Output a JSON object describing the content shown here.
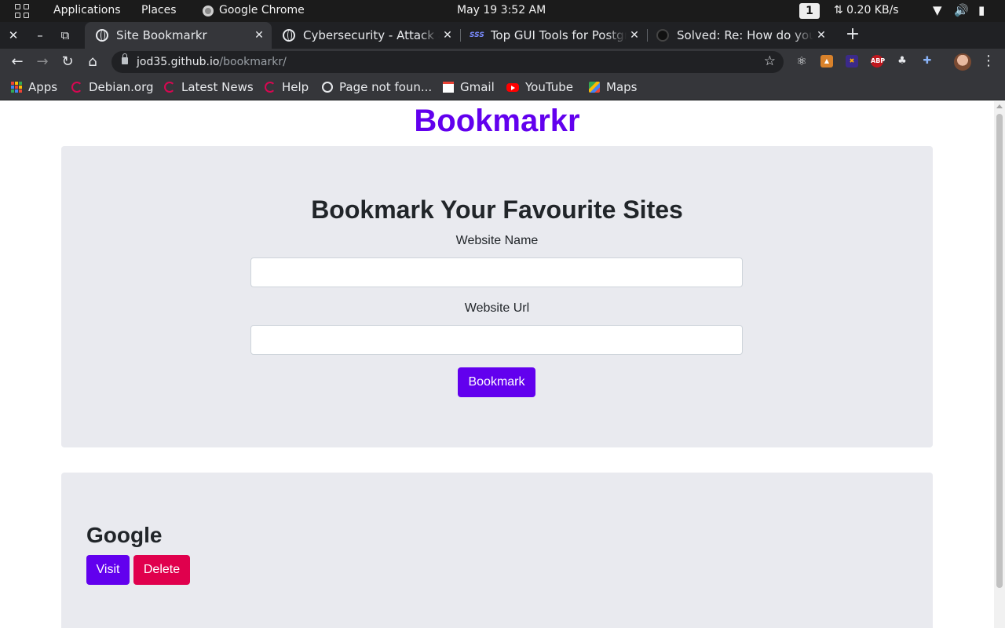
{
  "system_bar": {
    "applications": "Applications",
    "places": "Places",
    "active_app": "Google Chrome",
    "datetime": "May 19  3:52 AM",
    "workspace": "1",
    "net_speed": "⇅ 0.20 KB/s"
  },
  "tabs": [
    {
      "title": "Site Bookmarkr",
      "active": true
    },
    {
      "title": "Cybersecurity - Attack an",
      "active": false
    },
    {
      "title": "Top GUI Tools for Postgre",
      "active": false
    },
    {
      "title": "Solved: Re: How do you p",
      "active": false
    }
  ],
  "toolbar": {
    "url_host": "jod35.github.io",
    "url_path": "/bookmarkr/"
  },
  "bookmarks_bar": [
    {
      "label": "Apps",
      "icon": "apps-grid-icon"
    },
    {
      "label": "Debian.org",
      "icon": "debian-icon"
    },
    {
      "label": "Latest News",
      "icon": "debian-icon"
    },
    {
      "label": "Help",
      "icon": "debian-icon"
    },
    {
      "label": "Page not foun...",
      "icon": "globe-icon"
    },
    {
      "label": "Gmail",
      "icon": "gmail-icon"
    },
    {
      "label": "YouTube",
      "icon": "youtube-icon"
    },
    {
      "label": "Maps",
      "icon": "maps-icon"
    }
  ],
  "page": {
    "site_title": "Bookmarkr",
    "form": {
      "heading": "Bookmark Your Favourite Sites",
      "name_label": "Website Name",
      "name_value": "",
      "url_label": "Website Url",
      "url_value": "",
      "submit_label": "Bookmark"
    },
    "bookmarks": [
      {
        "name": "Google",
        "visit_label": "Visit",
        "delete_label": "Delete"
      }
    ]
  },
  "colors": {
    "brand": "#6200ee",
    "danger": "#e0004d",
    "card_bg": "#e9eaef"
  }
}
